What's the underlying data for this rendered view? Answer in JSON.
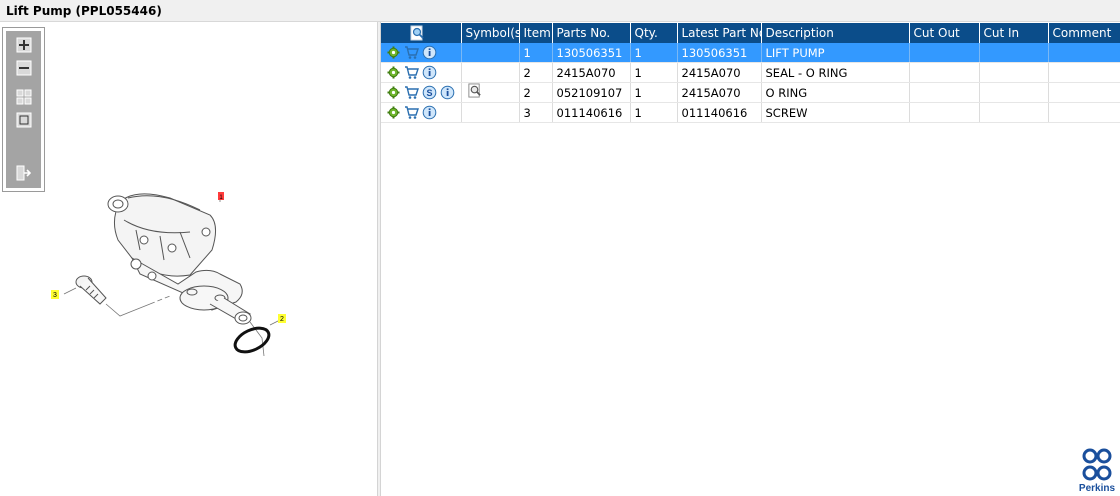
{
  "window": {
    "title": "Lift Pump (PPL055446)"
  },
  "viewer_toolbar": {
    "buttons": [
      {
        "name": "zoom-in",
        "icon": "plus-icon"
      },
      {
        "name": "zoom-out",
        "icon": "minus-icon"
      },
      {
        "name": "fit-all",
        "icon": "grid-icon"
      },
      {
        "name": "actual-size",
        "icon": "square-icon"
      },
      {
        "name": "export",
        "icon": "export-icon"
      }
    ]
  },
  "drawing": {
    "callouts": {
      "c1": "1",
      "c2": "2",
      "c3": "3"
    }
  },
  "parts_table": {
    "header_icon": "magnifier-page-icon",
    "columns": {
      "symbols": "Symbol(s)",
      "item": "Item",
      "parts_no": "Parts No.",
      "qty": "Qty.",
      "latest_part_no": "Latest Part No.",
      "description": "Description",
      "cut_out": "Cut Out",
      "cut_in": "Cut In",
      "comment": "Comment"
    },
    "rows": [
      {
        "item": "1",
        "parts_no": "130506351",
        "qty": "1",
        "latest_part_no": "130506351",
        "description": "LIFT PUMP",
        "cut_out": "",
        "cut_in": "",
        "comment": "",
        "selected": true,
        "s_icon": false,
        "symbol": ""
      },
      {
        "item": "2",
        "parts_no": "2415A070",
        "qty": "1",
        "latest_part_no": "2415A070",
        "description": "SEAL - O RING",
        "cut_out": "",
        "cut_in": "",
        "comment": "",
        "selected": false,
        "s_icon": false,
        "symbol": ""
      },
      {
        "item": "2",
        "parts_no": "052109107",
        "qty": "1",
        "latest_part_no": "2415A070",
        "description": "O RING",
        "cut_out": "",
        "cut_in": "",
        "comment": "",
        "selected": false,
        "s_icon": true,
        "symbol": "magnifier-page-icon"
      },
      {
        "item": "3",
        "parts_no": "011140616",
        "qty": "1",
        "latest_part_no": "011140616",
        "description": "SCREW",
        "cut_out": "",
        "cut_in": "",
        "comment": "",
        "selected": false,
        "s_icon": false,
        "symbol": ""
      }
    ]
  },
  "colors": {
    "header_bg": "#0b4d8a",
    "selected_row": "#3399ff",
    "callout_yellow": "#ffff33",
    "callout_red": "#ff3b3b",
    "brand_blue": "#1a4f9c"
  },
  "brand": {
    "logo_text": "Perkins"
  }
}
